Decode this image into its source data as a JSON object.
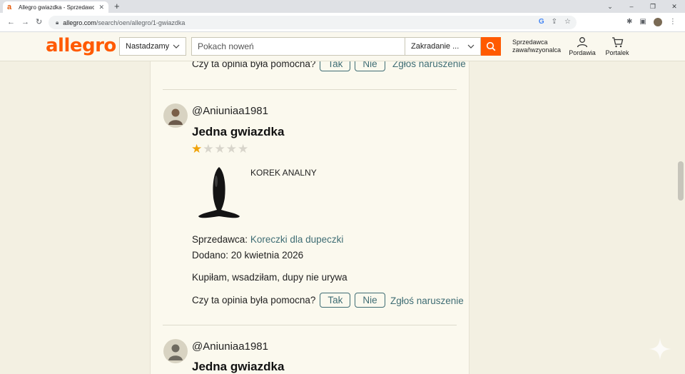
{
  "browser": {
    "tab_title": "Allegro gwiazdka - Sprzedawca",
    "url_host": "allegro.com",
    "url_path": "/search/oen/allegro/1-gwiazdka"
  },
  "header": {
    "logo": "allegro",
    "category_select": "Nastadzamy",
    "search_placeholder": "Pokach noweń",
    "search_scope": "Zakradanie ...",
    "seller_link": "Sprzedawca zawaňwzyonalca",
    "account_label": "Pordawia",
    "cart_label": "Portalek"
  },
  "top_review_footer": {
    "question": "Czy ta opinia była pomocna?",
    "yes": "Tak",
    "no": "Nie",
    "report": "Zgłoś naruszenie"
  },
  "reviews": [
    {
      "username": "@Aniuniaa1981",
      "title": "Jedna gwiazdka",
      "rating": 1,
      "rating_max": 5,
      "product_name": "KOREK ANALNY",
      "seller_label": "Sprzedawca:",
      "seller_name": "Koreczki dla dupeczki",
      "date": "Dodano: 20 kwietnia 2026",
      "text": "Kupiłam, wsadziłam, dupy nie urywa",
      "question": "Czy ta opinia była pomocna?",
      "yes": "Tak",
      "no": "Nie",
      "report": "Zgłoś naruszenie"
    },
    {
      "username": "@Aniuniaa1981",
      "title": "Jedna gwiazdka"
    }
  ],
  "colors": {
    "brand": "#ff5a00",
    "link": "#3f6d74",
    "star": "#f0a30a",
    "background": "#f3f0e2"
  }
}
